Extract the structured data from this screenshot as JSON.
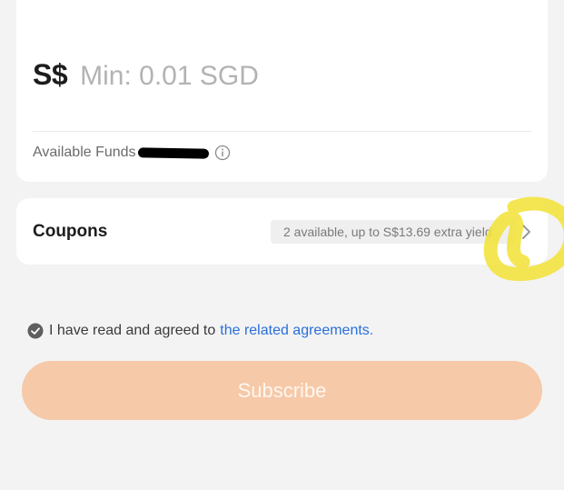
{
  "amount": {
    "currency_symbol": "S$",
    "placeholder": "Min: 0.01 SGD",
    "value": ""
  },
  "funds": {
    "label": "Available Funds",
    "info_icon": "info-circle-icon"
  },
  "coupons": {
    "title": "Coupons",
    "badge": "2 available, up to S$13.69 extra yield",
    "chevron_icon": "chevron-right-icon"
  },
  "agreement": {
    "text": "I have read and agreed to",
    "link_text": "the related agreements.",
    "checked": true,
    "check_icon": "check-circle-icon"
  },
  "subscribe": {
    "label": "Subscribe",
    "disabled": true
  },
  "colors": {
    "background": "#f3f3f3",
    "card": "#ffffff",
    "accent_button": "#f6c9a8",
    "link": "#2a6fdb",
    "highlight_mark": "#f3e23a"
  }
}
